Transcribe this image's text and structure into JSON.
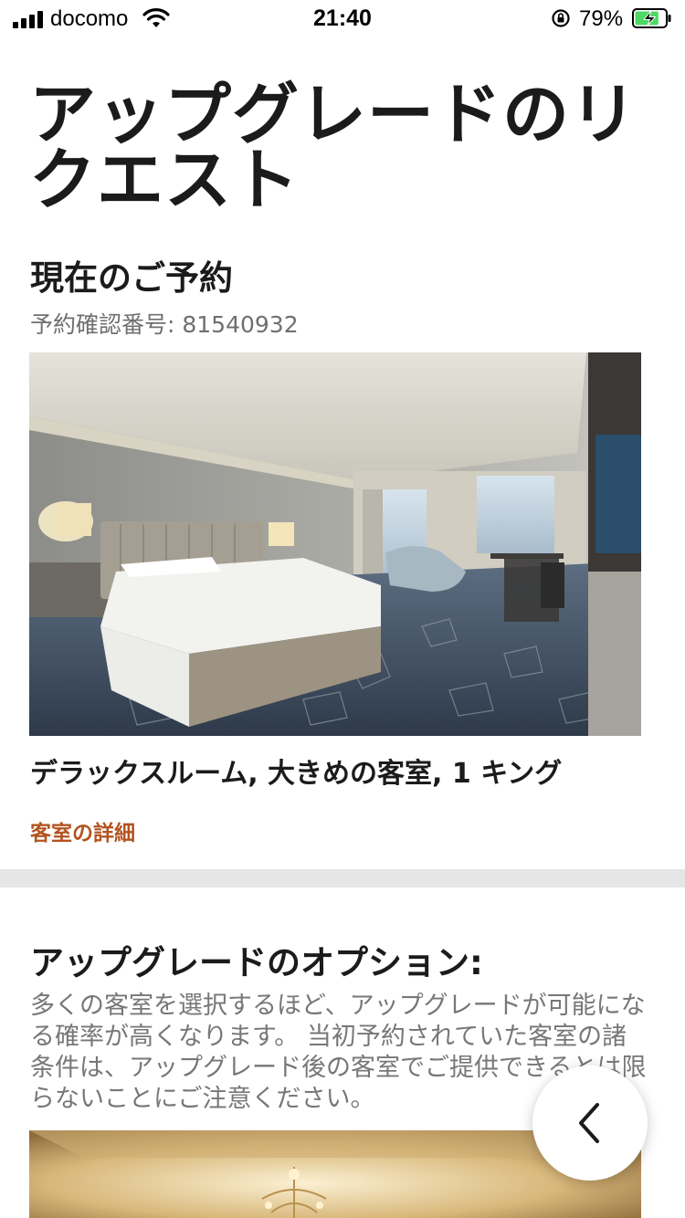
{
  "status_bar": {
    "carrier": "docomo",
    "time": "21:40",
    "battery_percent": "79%",
    "battery_level": 0.79
  },
  "page": {
    "title": "アップグレードのリクエスト"
  },
  "current_reservation": {
    "heading": "現在のご予約",
    "confirmation_label": "予約確認番号: 81540932",
    "room_name": "デラックスルーム, 大きめの客室, 1 キング",
    "room_details_link": "客室の詳細"
  },
  "upgrade_options": {
    "heading": "アップグレードのオプション:",
    "description": "多くの客室を選択するほど、アップグレードが可能になる確率が高くなります。 当初予約されていた客室の諸条件は、アップグレード後の客室でご提供できるとは限らないことにご注意ください。"
  },
  "colors": {
    "accent_link": "#b4531f",
    "divider": "#e6e6e6",
    "battery_charging": "#4cd964"
  },
  "icons": {
    "signal": "signal-bars-icon",
    "wifi": "wifi-icon",
    "rotation_lock": "rotation-lock-icon",
    "battery": "battery-charging-icon",
    "back": "chevron-left-icon"
  }
}
